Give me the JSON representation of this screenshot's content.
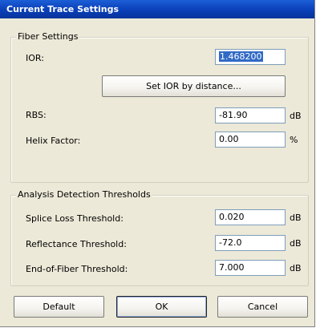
{
  "window": {
    "title": "Current Trace Settings"
  },
  "fiber_settings": {
    "title": "Fiber Settings",
    "ior_label": "IOR:",
    "ior_value": "1.468200",
    "set_ior_button": "Set IOR by distance...",
    "rbs_label": "RBS:",
    "rbs_value": "-81.90",
    "rbs_unit": "dB",
    "helix_label": "Helix Factor:",
    "helix_value": "0.00",
    "helix_unit": "%"
  },
  "thresholds": {
    "title": "Analysis Detection Thresholds",
    "splice_label": "Splice Loss Threshold:",
    "splice_value": "0.020",
    "splice_unit": "dB",
    "reflectance_label": "Reflectance Threshold:",
    "reflectance_value": "-72.0",
    "reflectance_unit": "dB",
    "eof_label": "End-of-Fiber Threshold:",
    "eof_value": "7.000",
    "eof_unit": "dB"
  },
  "buttons": {
    "default": "Default",
    "ok": "OK",
    "cancel": "Cancel"
  }
}
